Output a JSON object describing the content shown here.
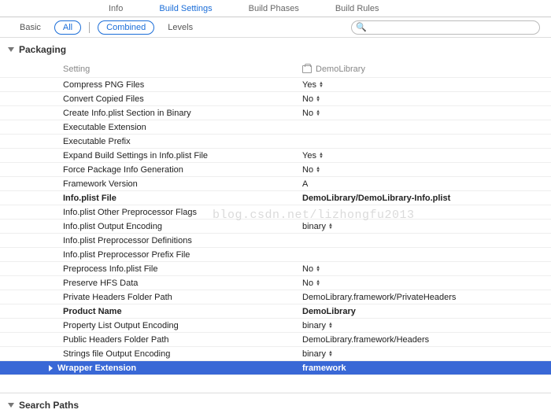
{
  "tabs": {
    "info": "Info",
    "buildSettings": "Build Settings",
    "buildPhases": "Build Phases",
    "buildRules": "Build Rules"
  },
  "filters": {
    "basic": "Basic",
    "all": "All",
    "combined": "Combined",
    "levels": "Levels"
  },
  "search": {
    "placeholder": ""
  },
  "target": {
    "name": "DemoLibrary"
  },
  "columns": {
    "setting": "Setting"
  },
  "sections": {
    "packaging": "Packaging",
    "searchPaths": "Search Paths"
  },
  "rows": [
    {
      "label": "Compress PNG Files",
      "value": "Yes",
      "stepper": true
    },
    {
      "label": "Convert Copied Files",
      "value": "No",
      "stepper": true
    },
    {
      "label": "Create Info.plist Section in Binary",
      "value": "No",
      "stepper": true
    },
    {
      "label": "Executable Extension",
      "value": ""
    },
    {
      "label": "Executable Prefix",
      "value": ""
    },
    {
      "label": "Expand Build Settings in Info.plist File",
      "value": "Yes",
      "stepper": true
    },
    {
      "label": "Force Package Info Generation",
      "value": "No",
      "stepper": true
    },
    {
      "label": "Framework Version",
      "value": "A"
    },
    {
      "label": "Info.plist File",
      "value": "DemoLibrary/DemoLibrary-Info.plist",
      "bold": true
    },
    {
      "label": "Info.plist Other Preprocessor Flags",
      "value": ""
    },
    {
      "label": "Info.plist Output Encoding",
      "value": "binary",
      "stepper": true
    },
    {
      "label": "Info.plist Preprocessor Definitions",
      "value": ""
    },
    {
      "label": "Info.plist Preprocessor Prefix File",
      "value": ""
    },
    {
      "label": "Preprocess Info.plist File",
      "value": "No",
      "stepper": true
    },
    {
      "label": "Preserve HFS Data",
      "value": "No",
      "stepper": true
    },
    {
      "label": "Private Headers Folder Path",
      "value": "DemoLibrary.framework/PrivateHeaders"
    },
    {
      "label": "Product Name",
      "value": "DemoLibrary",
      "bold": true
    },
    {
      "label": "Property List Output Encoding",
      "value": "binary",
      "stepper": true
    },
    {
      "label": "Public Headers Folder Path",
      "value": "DemoLibrary.framework/Headers"
    },
    {
      "label": "Strings file Output Encoding",
      "value": "binary",
      "stepper": true
    },
    {
      "label": "Wrapper Extension",
      "value": "framework",
      "selected": true
    }
  ],
  "watermark": "blog.csdn.net/lizhongfu2013"
}
